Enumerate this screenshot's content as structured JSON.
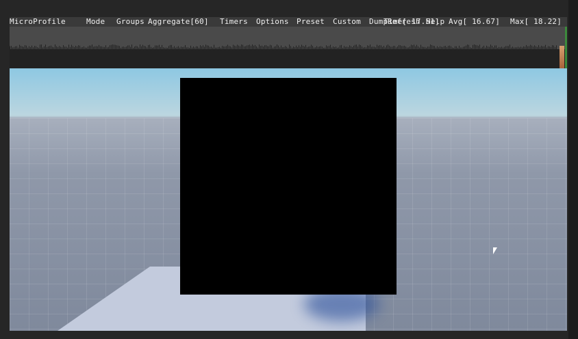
{
  "profiler": {
    "title": "MicroProfile",
    "menu": [
      "Mode",
      "Groups",
      "Aggregate[60]",
      "Timers",
      "Options",
      "Preset",
      "Custom",
      "Dump",
      "Refresh",
      "Help"
    ],
    "time": "Time[ 17.51]",
    "avg": "Avg[ 16.67]",
    "max": "Max[ 18.22]"
  },
  "colors": {
    "graph_bg": "#4a4a4a",
    "frame_spike": "#d9a070",
    "sky": "#8ec8e2"
  }
}
